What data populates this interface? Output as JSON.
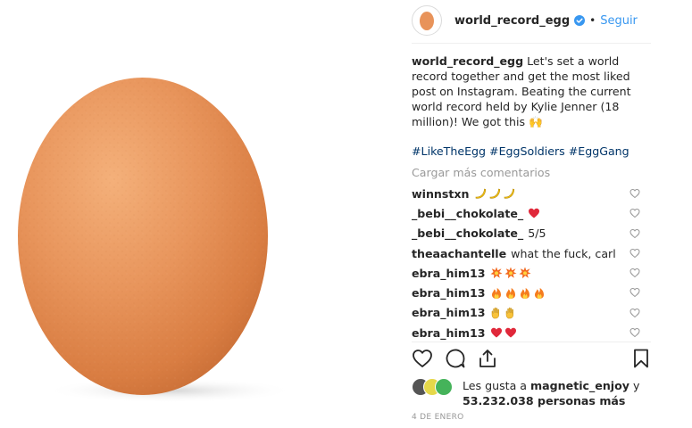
{
  "post": {
    "image_subject": "egg",
    "header": {
      "username": "world_record_egg",
      "separator": "•",
      "follow_label": "Seguir"
    },
    "caption": {
      "username": "world_record_egg",
      "text": "Let's set a world record together and get the most liked post on Instagram. Beating the current world record held by Kylie Jenner (18 million)! We got this 🙌",
      "hashtags": "#LikeTheEgg #EggSoldiers #EggGang"
    },
    "load_more_label": "Cargar más comentarios",
    "comments": [
      {
        "username": "winnstxn",
        "text": "",
        "emoji": "banana",
        "count": 3
      },
      {
        "username": "_bebi__chokolate_",
        "text": "",
        "emoji": "red-heart",
        "count": 1
      },
      {
        "username": "_bebi__chokolate_",
        "text": "5/5",
        "emoji": "",
        "count": 0
      },
      {
        "username": "theaachantelle",
        "text": "what the fuck, carl",
        "emoji": "",
        "count": 0
      },
      {
        "username": "ebra_him13",
        "text": "",
        "emoji": "collision",
        "count": 3
      },
      {
        "username": "ebra_him13",
        "text": "",
        "emoji": "fire",
        "count": 4
      },
      {
        "username": "ebra_him13",
        "text": "",
        "emoji": "raised-hand",
        "count": 2
      },
      {
        "username": "ebra_him13",
        "text": "",
        "emoji": "red-heart",
        "count": 2
      }
    ],
    "likes": {
      "prefix": "Les gusta a",
      "liker": "magnetic_enjoy",
      "joiner": "y",
      "others": "53.232.038 personas más"
    },
    "date": "4 DE ENERO",
    "icons": [
      "heart-icon",
      "comment-icon",
      "share-icon",
      "bookmark-icon",
      "verified-badge-icon"
    ],
    "colors": {
      "link": "#3897f0",
      "hashtag": "#003569",
      "muted": "#999999",
      "text": "#262626",
      "egg": "#e8935a"
    }
  }
}
